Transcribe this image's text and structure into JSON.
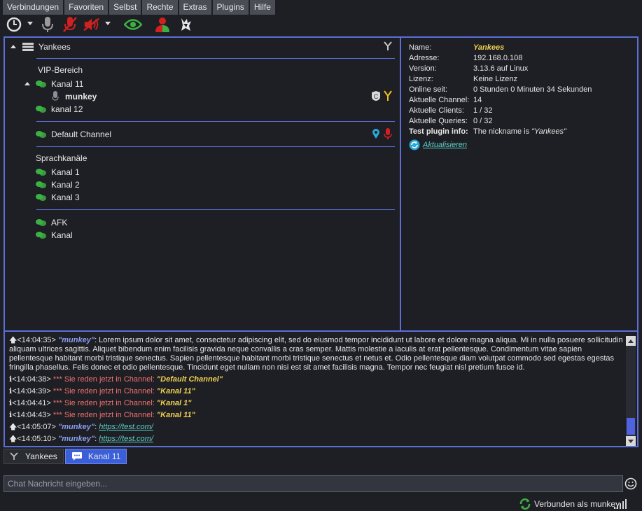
{
  "menu": [
    "Verbindungen",
    "Favoriten",
    "Selbst",
    "Rechte",
    "Extras",
    "Plugins",
    "Hilfe"
  ],
  "toolbar": {
    "icons": [
      "clock-icon",
      "microphone-icon",
      "microphone-muted-icon",
      "speaker-muted-icon",
      "eye-icon",
      "user-red-green-icon",
      "wolf-icon"
    ]
  },
  "tree": {
    "server": "Yankees",
    "vip": "VIP-Bereich",
    "kanal11": "Kanal 11",
    "user": "munkey",
    "kanal12": "kanal 12",
    "default": "Default Channel",
    "sprach": "Sprachkanäle",
    "kanal1": "Kanal 1",
    "kanal2": "Kanal 2",
    "kanal3": "Kanal 3",
    "afk": "AFK",
    "kanal": "Kanal"
  },
  "info": {
    "rows": [
      {
        "label": "Name:",
        "value": "Yankees"
      },
      {
        "label": "Adresse:",
        "value": "192.168.0.108"
      },
      {
        "label": "Version:",
        "value": "3.13.6 auf Linux"
      },
      {
        "label": "Lizenz:",
        "value": "Keine Lizenz"
      },
      {
        "label": "Online seit:",
        "value": "0 Stunden 0 Minuten 34 Sekunden"
      },
      {
        "label": "Aktuelle Channel:",
        "value": "14"
      },
      {
        "label": "Aktuelle Clients:",
        "value": "1 / 32"
      },
      {
        "label": "Aktuelle Queries:",
        "value": "0 / 32"
      },
      {
        "label": "Test plugin info:",
        "value": "The nickname is "
      },
      {
        "label": "",
        "value": "\"Yankees\""
      }
    ],
    "refresh": "Aktualisieren"
  },
  "chat": {
    "m1_time": "<14:04:35>",
    "m1_nick": "\"munkey\"",
    "m1_text": ": Lorem ipsum dolor sit amet, consectetur adipiscing elit, sed do eiusmod tempor incididunt ut labore et dolore magna aliqua. Mi in nulla posuere sollicitudin aliquam ultrices sagittis. Aliquet bibendum enim facilisis gravida neque convallis a cras semper. Mattis molestie a iaculis at erat pellentesque. Condimentum vitae sapien pellentesque habitant morbi tristique senectus. Sapien pellentesque habitant morbi tristique senectus et netus et. Odio pellentesque diam volutpat commodo sed egestas egestas fringilla phasellus. Felis donec et odio pellentesque. Tincidunt eget nullam non nisi est sit amet facilisis magna. Tempor nec feugiat nisl pretium fusce id.",
    "m2_time": "<14:04:38>",
    "m2_sys": "*** Sie reden jetzt in Channel:",
    "m2_chan": "\"Default Channel\"",
    "m3_time": "<14:04:39>",
    "m3_sys": "*** Sie reden jetzt in Channel:",
    "m3_chan": "\"Kanal 11\"",
    "m4_time": "<14:04:41>",
    "m4_sys": "*** Sie reden jetzt in Channel:",
    "m4_chan": "\"Kanal 1\"",
    "m5_time": "<14:04:43>",
    "m5_sys": "*** Sie reden jetzt in Channel:",
    "m5_chan": "\"Kanal 11\"",
    "m6_time": "<14:05:07>",
    "m6_nick": "\"munkey\"",
    "m6_link": "https://test.com/",
    "m7_time": "<14:05:10>",
    "m7_nick": "\"munkey\"",
    "m7_link": "https://test.com/",
    "colon": ":"
  },
  "tabs": {
    "server": "Yankees",
    "channel": "Kanal 11"
  },
  "input": {
    "placeholder": "Chat Nachricht eingeben..."
  },
  "status": {
    "text": "Verbunden als munkey"
  },
  "colors": {
    "accent": "#5a6fd8",
    "channel_green": "#3cb043",
    "system_red": "#f07070",
    "channel_yellow": "#f0d050"
  }
}
